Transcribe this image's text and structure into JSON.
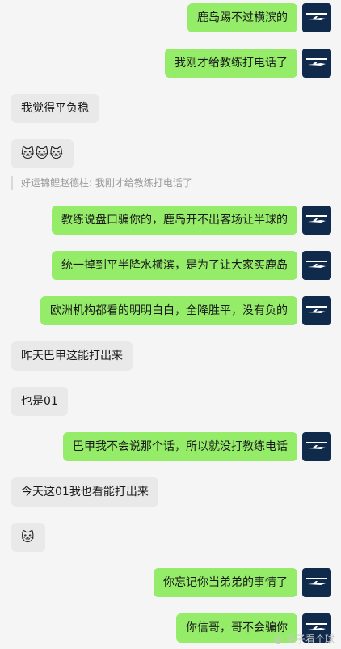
{
  "messages": [
    {
      "text": "鹿岛踢不过横滨的"
    },
    {
      "text": "我刚才给教练打电话了"
    },
    {
      "text": "我觉得平负稳"
    },
    {
      "text": "🐱🐱🐱"
    },
    {
      "text": "好运锦鲤赵德柱: 我刚才给教练打电话了"
    },
    {
      "text": "教练说盘口骗你的，鹿岛开不出客场让半球的"
    },
    {
      "text": "统一掉到平半降水横滨，是为了让大家买鹿岛"
    },
    {
      "text": "欧洲机构都看的明明白白，全降胜平，没有负的"
    },
    {
      "text": "昨天巴甲这能打出来"
    },
    {
      "text": "也是01"
    },
    {
      "text": "巴甲我不会说那个话，所以就没打教练电话"
    },
    {
      "text": "今天这01我也看能打出来"
    },
    {
      "text": "🐱"
    },
    {
      "text": "你忘记你当弟弟的事情了"
    },
    {
      "text": "你信哥，哥不会骗你"
    }
  ],
  "watermark": "@ 毛子看个球",
  "colors": {
    "outgoing_bubble": "#95ec69",
    "incoming_bubble": "#e9e9e9",
    "background": "#f5f5f5",
    "avatar": "#0f2a4a"
  },
  "icons": {
    "avatar": "aircraft-logo-icon"
  }
}
